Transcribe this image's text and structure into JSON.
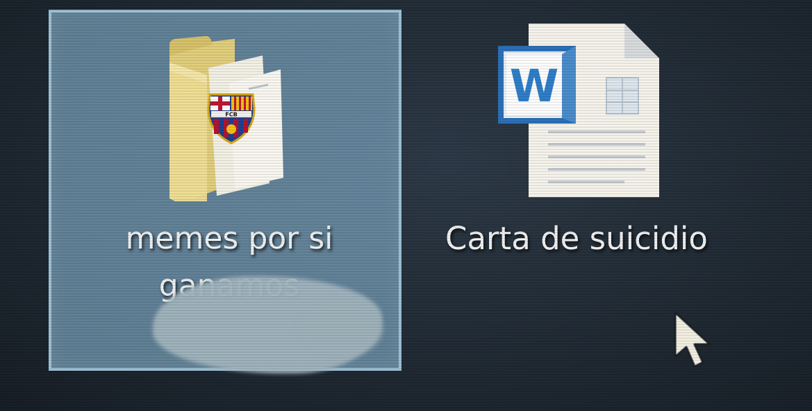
{
  "desktop": {
    "icons": [
      {
        "label": "memes por si\nganamos",
        "type": "folder",
        "selected": true,
        "badge": {
          "name": "fc-barcelona-crest",
          "text": "FCB"
        }
      },
      {
        "label": "Carta de suicidio",
        "type": "word-document",
        "selected": false,
        "app_glyph": "W"
      }
    ]
  },
  "colors": {
    "desktop_bg": "#1f2933",
    "selection_fill": "#7ca4be",
    "selection_border": "#aacee2",
    "label_text": "#f1f1f1",
    "word_blue": "#2b6fb7",
    "folder_yellow": "#e9d98c",
    "barca_blue": "#1f3f8f",
    "barca_red": "#b3122e"
  }
}
